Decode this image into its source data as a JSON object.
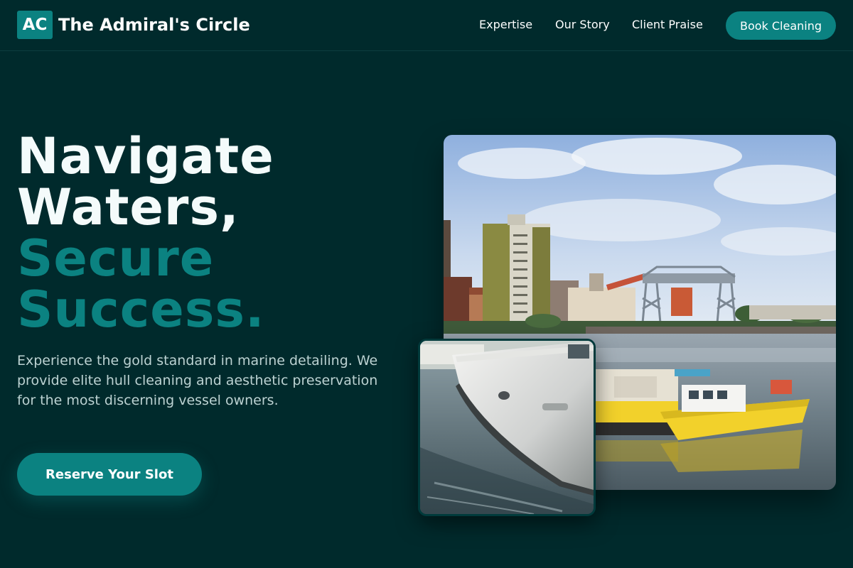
{
  "brand": {
    "logo_text": "AC",
    "name": "The Admiral's Circle"
  },
  "nav": {
    "links": [
      "Expertise",
      "Our Story",
      "Client Praise"
    ],
    "cta_label": "Book Cleaning"
  },
  "hero": {
    "title_line1": "Navigate",
    "title_line2": "Waters,",
    "title_line3": "Secure",
    "title_line4": "Success.",
    "subtitle": "Experience the gold standard in marine detailing. We provide elite hull cleaning and aesthetic preservation for the most discerning vessel owners.",
    "cta_label": "Reserve Your Slot"
  },
  "colors": {
    "background": "#002a2c",
    "accent": "#0b8281",
    "subtitle_text": "#bcd2d2"
  },
  "images": {
    "main": "harbor-with-yellow-boats-and-transporter-bridge-photo",
    "inset": "white-yacht-bow-on-water-photo"
  }
}
